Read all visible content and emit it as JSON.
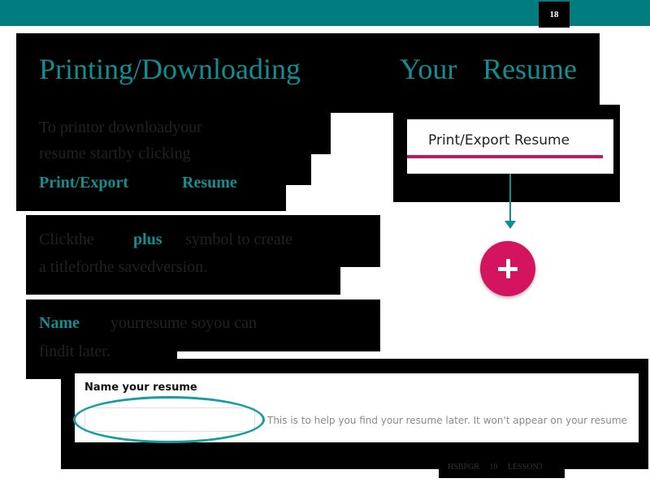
{
  "page_number": "18",
  "title": {
    "word1": "Printing/Downloading",
    "word2": "Your",
    "word3": "Resume"
  },
  "step1": {
    "line1": "To   printor      downloadyour",
    "line2": "resume        startby       clicking",
    "bold_a": "Print/Export",
    "bold_b": "Resume"
  },
  "step2": {
    "line1_a": "Clickthe",
    "line1_b": "plus",
    "line1_c": "symbol      to   create",
    "line2": "a  titleforthe         savedversion."
  },
  "step3": {
    "bold": "Name",
    "line1": "yourresume        soyou        can",
    "line2": "findit      later."
  },
  "export_button": {
    "label": "Print/Export Resume"
  },
  "name_dialog": {
    "header": "Name your resume",
    "input_value": "",
    "hint": "This is to help you find your resume later. It won't appear on your resume"
  },
  "footer": {
    "code": "HSBPGR",
    "unit": "10",
    "lesson": "LESSON3"
  },
  "colors": {
    "teal": "#017c7f",
    "accent_teal": "#0f8f92",
    "magenta": "#d5145f",
    "underline": "#c0185f"
  },
  "icons": {
    "plus": "plus-icon",
    "arrow": "arrow-down-icon"
  }
}
